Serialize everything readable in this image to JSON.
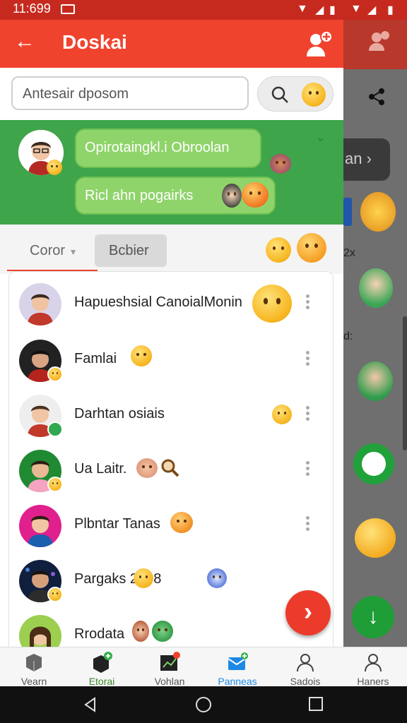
{
  "status_bar": {
    "time": "11:699"
  },
  "app_bar": {
    "title": "Doskai"
  },
  "search": {
    "placeholder": "Antesair dposom"
  },
  "chat": {
    "bubble_1": "Opirotaingkl.i Obroolan",
    "bubble_2": "Ricl ahn pogairks"
  },
  "filters": {
    "dropdown_label": "Coror",
    "button_label": "Bcbier"
  },
  "contacts": [
    {
      "name": "Hapueshsial CanoialMonin"
    },
    {
      "name": "Famlai"
    },
    {
      "name": "Darhtan osiais"
    },
    {
      "name": "Ua Laitr."
    },
    {
      "name": "Plbntar Tanas"
    },
    {
      "name": "Pargaks 2008"
    },
    {
      "name": "Rrodata"
    }
  ],
  "bottom_nav": [
    {
      "label": "Vearn",
      "icon": "cube-icon"
    },
    {
      "label": "Etorai",
      "icon": "box-plus-icon"
    },
    {
      "label": "Vohlan",
      "icon": "chart-badge-icon"
    },
    {
      "label": "Panneas",
      "icon": "mail-plus-icon",
      "active": true
    },
    {
      "label": "Sadois",
      "icon": "person-icon"
    },
    {
      "label": "Haners",
      "icon": "person-icon"
    }
  ],
  "background_panel": {
    "pill_text": "an",
    "tags": [
      "2x",
      "d:"
    ]
  },
  "colors": {
    "app_bar": "#f0432e",
    "status_bar": "#c62a1e",
    "green_area": "#3fa54a",
    "bubble": "#8fd46a",
    "fab": "#ec3b2a",
    "active_nav": "#1e88e5"
  }
}
